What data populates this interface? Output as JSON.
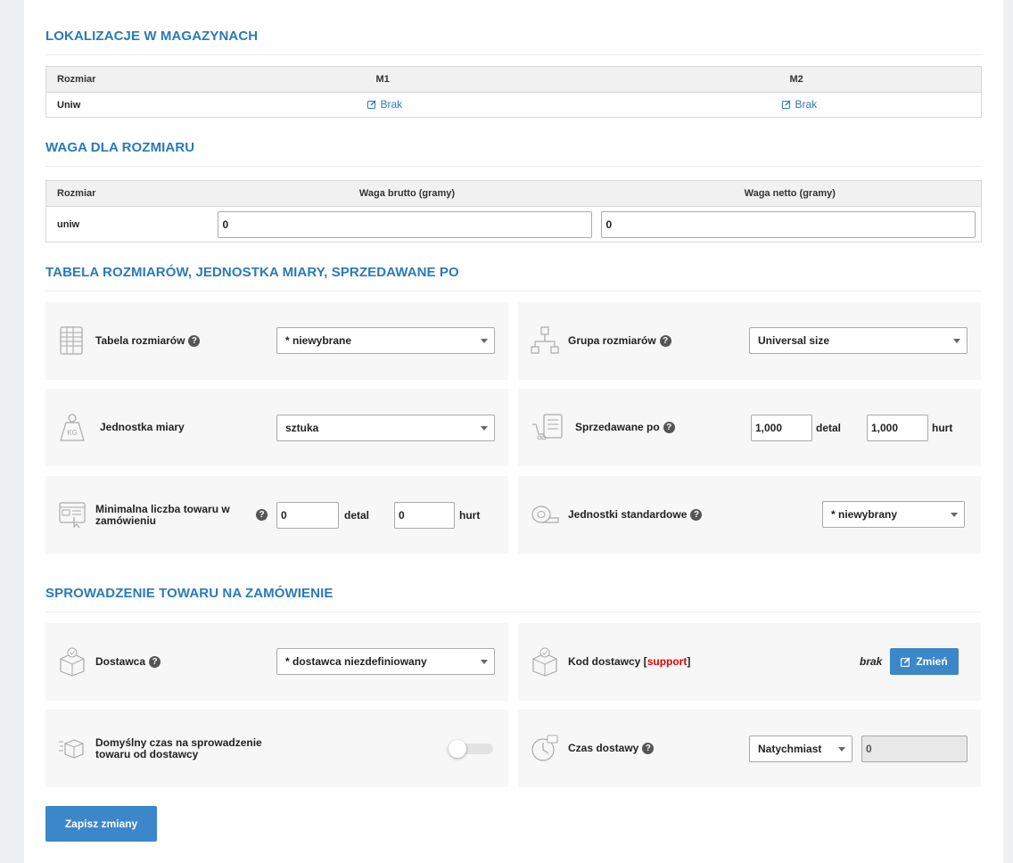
{
  "sections": {
    "locations": "LOKALIZACJE W MAGAZYNACH",
    "weight": "WAGA DLA ROZMIARU",
    "sizes": "TABELA ROZMIARÓW, JEDNOSTKA MIARY, SPRZEDAWANE PO",
    "check": "SPROWADZENIE TOWARU NA ZAMÓWIENIE"
  },
  "locations_table": {
    "headers": [
      "Rozmiar",
      "M1",
      "M2"
    ],
    "row": {
      "size": "Uniw",
      "m1": "Brak",
      "m2": "Brak"
    }
  },
  "weight_table": {
    "headers": [
      "Rozmiar",
      "Waga brutto (gramy)",
      "Waga netto (gramy)"
    ],
    "row": {
      "size": "uniw",
      "brutto": "0",
      "netto": "0"
    }
  },
  "size_table": {
    "label": "Tabela rozmiarów",
    "value": "* niewybrane"
  },
  "size_group": {
    "label": "Grupa rozmiarów",
    "value": "Universal size"
  },
  "unit": {
    "label": "Jednostka miary",
    "value": "sztuka"
  },
  "sold_by": {
    "label": "Sprzedawane po",
    "retail_value": "1,000",
    "retail_label": "detal",
    "wholesale_value": "1,000",
    "wholesale_label": "hurt"
  },
  "min_qty": {
    "label_line1": "Minimalna liczba towaru w",
    "label_line2": "zamówieniu",
    "retail_value": "0",
    "retail_label": "detal",
    "wholesale_value": "0",
    "wholesale_label": "hurt"
  },
  "std_units": {
    "label": "Jednostki standardowe",
    "value": "* niewybrany"
  },
  "supplier": {
    "label": "Dostawca",
    "value": "* dostawca niezdefiniowany"
  },
  "supplier_code": {
    "label_prefix": "Kod dostawcy [",
    "label_link": "support",
    "label_suffix": "]",
    "value": "brak",
    "button": "Zmień"
  },
  "default_time": {
    "label_line1": "Domyślny czas na sprowadzenie",
    "label_line2": "towaru od dostawcy",
    "toggle_on": false
  },
  "delivery_time": {
    "label": "Czas dostawy",
    "select_value": "Natychmiast",
    "input_value": "0"
  },
  "help_glyph": "?",
  "save_button": "Zapisz zmiany",
  "colors": {
    "accent": "#2a7ab8",
    "button": "#3c87c9",
    "link_red": "#e00000"
  }
}
